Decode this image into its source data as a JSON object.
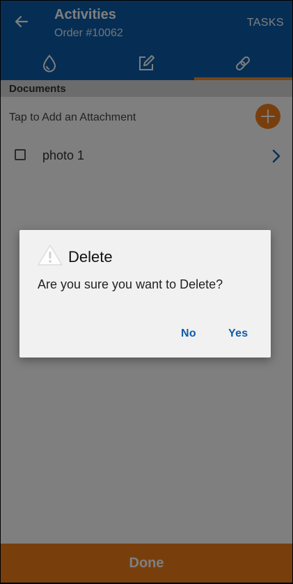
{
  "header": {
    "title": "Activities",
    "subtitle": "Order #10062",
    "action_label": "TASKS",
    "tabs": [
      {
        "icon": "water-drop-icon"
      },
      {
        "icon": "edit-note-icon"
      },
      {
        "icon": "attachment-icon",
        "selected": true
      }
    ]
  },
  "documents": {
    "section_label": "Documents",
    "add_label": "Tap to Add an Attachment",
    "items": [
      {
        "label": "photo 1",
        "checked": false
      }
    ]
  },
  "footer": {
    "done_label": "Done"
  },
  "dialog": {
    "icon": "warning-icon",
    "title": "Delete",
    "message": "Are you sure you want to Delete?",
    "no_label": "No",
    "yes_label": "Yes"
  },
  "colors": {
    "header_bg": "#0d5ca8",
    "accent": "#f07f1a",
    "dialog_button": "#0d5ca8"
  }
}
